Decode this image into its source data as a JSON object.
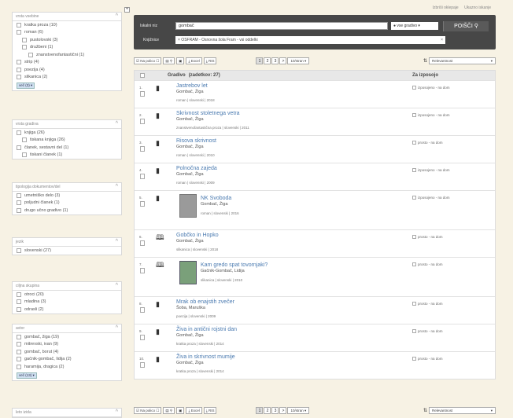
{
  "top_links": [
    "Izbriši oklepaje",
    "Ukazno iskanje"
  ],
  "search": {
    "label_query": "Iskalni niz",
    "query": "gombač",
    "scope": "vse gradivo",
    "button": "POIŠČI",
    "label_libraries": "Knjižnice",
    "library": "× OSFRAM - Osnovna šola Fram - vsi oddelki"
  },
  "toolbar": {
    "put_on_list": "Na polico",
    "save": "Excel",
    "export": "RIS",
    "pages": [
      "1",
      "2",
      "3"
    ],
    "next": ">",
    "per_page": "10/stran",
    "sort": "Relevantnost"
  },
  "results": {
    "col_material": "Gradivo",
    "col_count": "(zadetkov: 27)",
    "col_loan": "Za izposojo",
    "items": [
      {
        "num": "1.",
        "title": "Jastrebov let",
        "author": "Gombač, Žiga",
        "meta": "roman | slovenski | 2018",
        "avail": "izposojeno - na dom",
        "icon": "book"
      },
      {
        "num": "2.",
        "title": "Skrivnost stoletnega vetra",
        "author": "Gombač, Žiga",
        "meta": "znanstvenofantastična proza | slovenski | 2011",
        "avail": "izposojeno - na dom",
        "icon": "book"
      },
      {
        "num": "3.",
        "title": "Risova skrivnost",
        "author": "Gombač, Žiga",
        "meta": "roman | slovenski | 2010",
        "avail": "prosto - na dom",
        "icon": "book"
      },
      {
        "num": "4.",
        "title": "Polnočna zajeda",
        "author": "Gombač, Žiga",
        "meta": "roman | slovenski | 2009",
        "avail": "izposojeno - na dom",
        "icon": "book"
      },
      {
        "num": "5.",
        "title": "NK Svoboda",
        "author": "Gombač, Žiga",
        "meta": "roman | slovenski | 2016",
        "avail": "izposojeno - na dom",
        "icon": "book",
        "cover": true
      },
      {
        "num": "6.",
        "title": "Gobčko in Hopko",
        "author": "Gombač, Žiga",
        "meta": "slikanica | slovenski | 2018",
        "avail": "prosto - na dom",
        "icon": "openbook"
      },
      {
        "num": "7.",
        "title": "Kam gredo spat tovornjaki?",
        "author": "Gačnik-Gombač, Lidija",
        "meta": "slikanica | slovenski | 2010",
        "avail": "prosto - na dom",
        "icon": "openbook",
        "cover": true
      },
      {
        "num": "8.",
        "title": "Mrak ob enajstih zvečer",
        "author": "Šoba, Maruška",
        "meta": "poezija | slovenski | 2009",
        "avail": "prosto - na dom",
        "icon": "book"
      },
      {
        "num": "9.",
        "title": "Živa in antični rojstni dan",
        "author": "Gombač, Žiga",
        "meta": "kratka proza | slovenski | 2014",
        "avail": "prosto - na dom",
        "icon": "book"
      },
      {
        "num": "10.",
        "title": "Živa in skrivnost mumije",
        "author": "Gombač, Žiga",
        "meta": "kratka proza | slovenski | 2014",
        "avail": "prosto - na dom",
        "icon": "book"
      }
    ]
  },
  "facets": [
    {
      "title": "vrsta vsebine",
      "items": [
        {
          "label": "kratka proza (10)",
          "lvl": 1
        },
        {
          "label": "roman (6)",
          "lvl": 1
        },
        {
          "label": "pustolovski (3)",
          "lvl": 2
        },
        {
          "label": "družbeni (1)",
          "lvl": 2
        },
        {
          "label": "znanstvenofantastični (1)",
          "lvl": 3
        },
        {
          "label": "strip (4)",
          "lvl": 1
        },
        {
          "label": "poezija (4)",
          "lvl": 1
        },
        {
          "label": "slikanica (2)",
          "lvl": 1
        }
      ],
      "more": "več (3) ▾"
    },
    {
      "title": "vrsta gradiva",
      "items": [
        {
          "label": "knjiga (26)",
          "lvl": 1
        },
        {
          "label": "tiskana knjiga (26)",
          "lvl": 2
        },
        {
          "label": "članek, sestavni del (1)",
          "lvl": 1
        },
        {
          "label": "tiskani članek (1)",
          "lvl": 2
        }
      ]
    },
    {
      "title": "tipologija dokumentov/del",
      "items": [
        {
          "label": "umetniško delo (3)",
          "lvl": 1
        },
        {
          "label": "poljudni članek (1)",
          "lvl": 1
        },
        {
          "label": "drugo učno gradivo (1)",
          "lvl": 1
        }
      ]
    },
    {
      "title": "jezik",
      "items": [
        {
          "label": "slovenski (27)",
          "lvl": 1
        }
      ]
    },
    {
      "title": "ciljna skupina",
      "items": [
        {
          "label": "otroci (20)",
          "lvl": 1
        },
        {
          "label": "mladina (3)",
          "lvl": 1
        },
        {
          "label": "odrasli (2)",
          "lvl": 1
        }
      ]
    },
    {
      "title": "avtor",
      "items": [
        {
          "label": "gombač, žiga (19)",
          "lvl": 1
        },
        {
          "label": "mitrevski, ivan (9)",
          "lvl": 1
        },
        {
          "label": "gombač, borut (4)",
          "lvl": 1
        },
        {
          "label": "gačnik-gombač, lidija (2)",
          "lvl": 1
        },
        {
          "label": "haramija, dragica (2)",
          "lvl": 1
        }
      ],
      "more": "več (13) ▾"
    },
    {
      "title": "leto izida",
      "items": []
    }
  ]
}
